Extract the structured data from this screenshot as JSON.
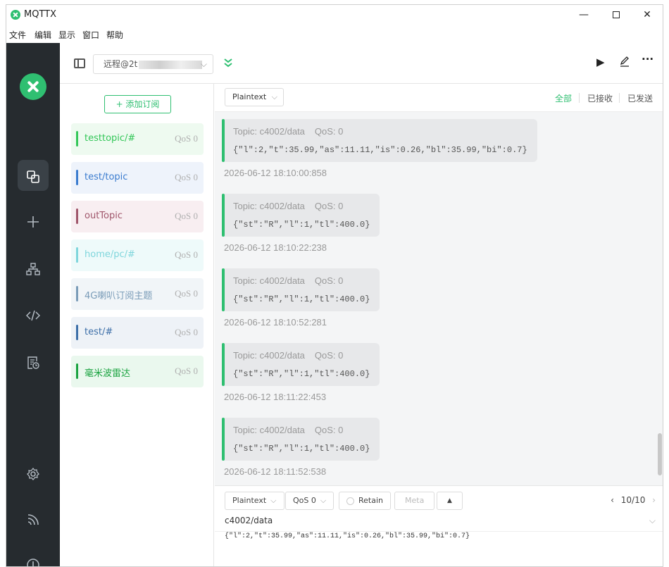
{
  "app": {
    "title": "MQTTX"
  },
  "window_controls": {
    "minimize": "—",
    "maximize": "",
    "close": "✕"
  },
  "menu": [
    "文件",
    "编辑",
    "显示",
    "窗口",
    "帮助"
  ],
  "nav_icons": [
    "connections-icon",
    "add-icon",
    "topology-icon",
    "script-icon",
    "log-icon",
    "settings-icon",
    "feed-icon",
    "about-icon"
  ],
  "connection": {
    "name": "远程@2t",
    "chevron": "⌵"
  },
  "toolbar": {
    "play": "▶",
    "edit": "✎",
    "more": "···"
  },
  "subscriptions": {
    "add_label": "+ 添加订阅",
    "items": [
      {
        "topic": "testtopic/#",
        "qos": "QoS 0",
        "color": "#34c759",
        "bg": "#eefaf0"
      },
      {
        "topic": "test/topic",
        "qos": "QoS 0",
        "color": "#3b7ccf",
        "bg": "#eef3fb"
      },
      {
        "topic": "outTopic",
        "qos": "QoS 0",
        "color": "#a0566b",
        "bg": "#f8eef1"
      },
      {
        "topic": "home/pc/#",
        "qos": "QoS 0",
        "color": "#7fd6dc",
        "bg": "#eefafa"
      },
      {
        "topic": "4G喇叭订阅主题",
        "qos": "QoS 0",
        "color": "#7a9cb8",
        "bg": "#f1f5f8"
      },
      {
        "topic": "test/#",
        "qos": "QoS 0",
        "color": "#3d6fa8",
        "bg": "#eef2f7"
      },
      {
        "topic": "毫米波雷达",
        "qos": "QoS 0",
        "color": "#1aa340",
        "bg": "#eaf8ee"
      }
    ]
  },
  "filter": {
    "format": "Plaintext",
    "tabs": [
      "全部",
      "已接收",
      "已发送"
    ]
  },
  "messages": [
    {
      "topic": "Topic: c4002/data",
      "qos": "QoS: 0",
      "payload": "{\"l\":2,\"t\":35.99,\"as\":11.11,\"is\":0.26,\"bl\":35.99,\"bi\":0.7}",
      "time": "2026-06-12 18:10:00:858"
    },
    {
      "topic": "Topic: c4002/data",
      "qos": "QoS: 0",
      "payload": "{\"st\":\"R\",\"l\":1,\"tl\":400.0}",
      "time": "2026-06-12 18:10:22:238"
    },
    {
      "topic": "Topic: c4002/data",
      "qos": "QoS: 0",
      "payload": "{\"st\":\"R\",\"l\":1,\"tl\":400.0}",
      "time": "2026-06-12 18:10:52:281"
    },
    {
      "topic": "Topic: c4002/data",
      "qos": "QoS: 0",
      "payload": "{\"st\":\"R\",\"l\":1,\"tl\":400.0}",
      "time": "2026-06-12 18:11:22:453"
    },
    {
      "topic": "Topic: c4002/data",
      "qos": "QoS: 0",
      "payload": "{\"st\":\"R\",\"l\":1,\"tl\":400.0}",
      "time": "2026-06-12 18:11:52:538"
    }
  ],
  "publish": {
    "format": "Plaintext",
    "qos": "QoS 0",
    "retain": "Retain",
    "meta": "Meta",
    "expand": "▲",
    "page": "10/10",
    "topic": "c4002/data",
    "payload": "{\"l\":2,\"t\":35.99,\"as\":11.11,\"is\":0.26,\"bl\":35.99,\"bi\":0.7}"
  }
}
